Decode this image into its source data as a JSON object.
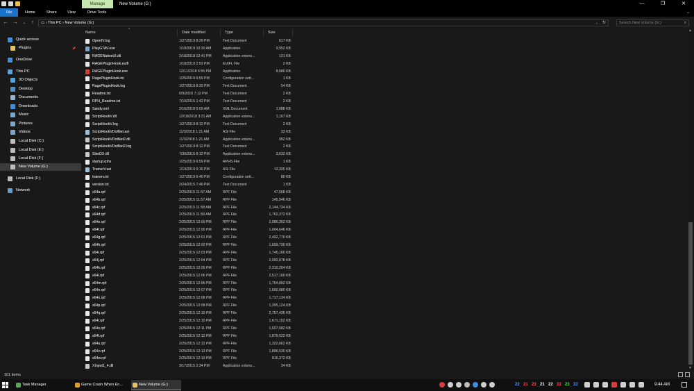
{
  "window": {
    "title": "New Volume (G:)",
    "manage_tab": "Manage",
    "minimize": "—",
    "maximize": "❐",
    "close": "✕"
  },
  "ribbon": {
    "tabs": [
      "File",
      "Home",
      "Share",
      "View",
      "Drive Tools"
    ],
    "expand": "⌄"
  },
  "address": {
    "back": "←",
    "forward": "→",
    "recent": "⌄",
    "up": "↑",
    "path": [
      "This PC",
      "New Volume (G:)"
    ],
    "separator": "›",
    "search_placeholder": "Search New Volume (G:)"
  },
  "sidebar": {
    "items": [
      {
        "label": "Quick access",
        "icon": "star-icon",
        "color": "#3b8ee0",
        "level": 0
      },
      {
        "label": "Plugins",
        "icon": "folder-icon",
        "color": "#e8c25a",
        "level": 1,
        "pinned": true
      },
      {
        "label": "OneDrive",
        "icon": "cloud-icon",
        "color": "#3b8ee0",
        "level": 0
      },
      {
        "label": "This PC",
        "icon": "computer-icon",
        "color": "#5aa0d8",
        "level": 0
      },
      {
        "label": "3D Objects",
        "icon": "cube-icon",
        "color": "#4da3e0",
        "level": 1
      },
      {
        "label": "Desktop",
        "icon": "desktop-icon",
        "color": "#4a90d0",
        "level": 1
      },
      {
        "label": "Documents",
        "icon": "documents-icon",
        "color": "#8fb3d0",
        "level": 1
      },
      {
        "label": "Downloads",
        "icon": "download-icon",
        "color": "#3b8ee0",
        "level": 1
      },
      {
        "label": "Music",
        "icon": "music-icon",
        "color": "#7aa7cf",
        "level": 1
      },
      {
        "label": "Pictures",
        "icon": "pictures-icon",
        "color": "#7aa7cf",
        "level": 1
      },
      {
        "label": "Videos",
        "icon": "videos-icon",
        "color": "#7aa7cf",
        "level": 1
      },
      {
        "label": "Local Disk (C:)",
        "icon": "drive-icon",
        "color": "#bdbdbd",
        "level": 1
      },
      {
        "label": "Local Disk (E:)",
        "icon": "drive-icon",
        "color": "#bdbdbd",
        "level": 1
      },
      {
        "label": "Local Disk (F:)",
        "icon": "drive-icon",
        "color": "#bdbdbd",
        "level": 1
      },
      {
        "label": "New Volume (G:)",
        "icon": "drive-icon",
        "color": "#bdbdbd",
        "level": 1,
        "selected": true
      },
      {
        "label": "Local Disk (F:)",
        "icon": "drive-icon",
        "color": "#bdbdbd",
        "level": 0
      },
      {
        "label": "Network",
        "icon": "network-icon",
        "color": "#5aa0d8",
        "level": 0
      }
    ]
  },
  "columns": {
    "name": "Name",
    "date": "Date modified",
    "type": "Type",
    "size": "Size",
    "sort_indicator": "^"
  },
  "files": [
    {
      "name": "OpenIV.log",
      "date": "1/27/2019 8:29 PM",
      "type": "Text Document",
      "size": "617 KB",
      "kind": "txt"
    },
    {
      "name": "PlayGTAV.exe",
      "date": "1/18/2019 10:30 AM",
      "type": "Application",
      "size": "9,952 KB",
      "kind": "exe"
    },
    {
      "name": "RAGENativeUI.dll",
      "date": "2/18/2018 12:41 PM",
      "type": "Application extens...",
      "size": "121 KB",
      "kind": "dll"
    },
    {
      "name": "RAGEPluginHook.euifi",
      "date": "1/18/2019 2:52 PM",
      "type": "EUIFL File",
      "size": "2 KB",
      "kind": "txt"
    },
    {
      "name": "RAGEPluginHook.exe",
      "date": "12/11/2018 6:55 PM",
      "type": "Application",
      "size": "8,580 KB",
      "kind": "rage"
    },
    {
      "name": "RagePluginHook.ini",
      "date": "1/25/2019 6:59 PM",
      "type": "Configuration sett...",
      "size": "1 KB",
      "kind": "txt"
    },
    {
      "name": "RagePluginHook.log",
      "date": "1/27/2019 8:32 PM",
      "type": "Text Document",
      "size": "54 KB",
      "kind": "txt"
    },
    {
      "name": "Readme.txt",
      "date": "6/9/2016 7:12 PM",
      "type": "Text Document",
      "size": "2 KB",
      "kind": "txt"
    },
    {
      "name": "RPH_Readme.txt",
      "date": "7/10/2015 1:42 PM",
      "type": "Text Document",
      "size": "2 KB",
      "kind": "txt"
    },
    {
      "name": "Sandy.xml",
      "date": "2/16/2018 5:09 AM",
      "type": "XML Document",
      "size": "1,088 KB",
      "kind": "txt"
    },
    {
      "name": "ScriptHookV.dll",
      "date": "12/18/2018 3:21 AM",
      "type": "Application extens...",
      "size": "1,167 KB",
      "kind": "dll"
    },
    {
      "name": "ScriptHookV.log",
      "date": "1/27/2019 8:12 PM",
      "type": "Text Document",
      "size": "2 KB",
      "kind": "txt"
    },
    {
      "name": "ScriptHookVDotNet.asi",
      "date": "11/3/2018 1:21 AM",
      "type": "ASI File",
      "size": "33 KB",
      "kind": "asi"
    },
    {
      "name": "ScriptHookVDotNet2.dll",
      "date": "11/3/2018 1:21 AM",
      "type": "Application extens...",
      "size": "992 KB",
      "kind": "dll"
    },
    {
      "name": "ScriptHookVDotNet2.log",
      "date": "1/27/2019 8:12 PM",
      "type": "Text Document",
      "size": "2 KB",
      "kind": "txt"
    },
    {
      "name": "SlimDX.dll",
      "date": "7/30/2015 8:12 PM",
      "type": "Application extens...",
      "size": "3,632 KB",
      "kind": "dll"
    },
    {
      "name": "startup.rphs",
      "date": "1/25/2019 6:59 PM",
      "type": "RPHS File",
      "size": "1 KB",
      "kind": "txt"
    },
    {
      "name": "TrainerV.asi",
      "date": "1/19/2019 9:15 PM",
      "type": "ASI File",
      "size": "13,305 KB",
      "kind": "asi"
    },
    {
      "name": "trainerv.ini",
      "date": "1/27/2019 6:40 PM",
      "type": "Configuration sett...",
      "size": "80 KB",
      "kind": "txt"
    },
    {
      "name": "version.txt",
      "date": "2/24/2015 7:49 PM",
      "type": "Text Document",
      "size": "1 KB",
      "kind": "txt"
    },
    {
      "name": "x64a.rpf",
      "date": "2/25/2015 11:57 AM",
      "type": "RPF File",
      "size": "47,558 KB",
      "kind": "txt"
    },
    {
      "name": "x64b.rpf",
      "date": "2/25/2015 11:57 AM",
      "type": "RPF File",
      "size": "145,946 KB",
      "kind": "txt"
    },
    {
      "name": "x64c.rpf",
      "date": "2/25/2015 11:58 AM",
      "type": "RPF File",
      "size": "2,144,734 KB",
      "kind": "txt"
    },
    {
      "name": "x64d.rpf",
      "date": "2/25/2015 11:59 AM",
      "type": "RPF File",
      "size": "1,762,372 KB",
      "kind": "txt"
    },
    {
      "name": "x64e.rpf",
      "date": "2/25/2015 12:00 PM",
      "type": "RPF File",
      "size": "2,086,362 KB",
      "kind": "txt"
    },
    {
      "name": "x64f.rpf",
      "date": "2/25/2015 12:00 PM",
      "type": "RPF File",
      "size": "1,004,646 KB",
      "kind": "txt"
    },
    {
      "name": "x64g.rpf",
      "date": "2/25/2015 12:01 PM",
      "type": "RPF File",
      "size": "2,492,770 KB",
      "kind": "txt"
    },
    {
      "name": "x64h.rpf",
      "date": "2/25/2015 12:02 PM",
      "type": "RPF File",
      "size": "1,659,730 KB",
      "kind": "txt"
    },
    {
      "name": "x64i.rpf",
      "date": "2/25/2015 12:03 PM",
      "type": "RPF File",
      "size": "1,745,160 KB",
      "kind": "txt"
    },
    {
      "name": "x64j.rpf",
      "date": "2/25/2015 12:04 PM",
      "type": "RPF File",
      "size": "2,090,078 KB",
      "kind": "txt"
    },
    {
      "name": "x64k.rpf",
      "date": "2/25/2015 12:05 PM",
      "type": "RPF File",
      "size": "2,310,204 KB",
      "kind": "txt"
    },
    {
      "name": "x64l.rpf",
      "date": "2/25/2015 12:06 PM",
      "type": "RPF File",
      "size": "2,517,160 KB",
      "kind": "txt"
    },
    {
      "name": "x64m.rpf",
      "date": "2/25/2015 12:06 PM",
      "type": "RPF File",
      "size": "1,764,892 KB",
      "kind": "txt"
    },
    {
      "name": "x64n.rpf",
      "date": "2/25/2015 12:07 PM",
      "type": "RPF File",
      "size": "1,600,080 KB",
      "kind": "txt"
    },
    {
      "name": "x64o.rpf",
      "date": "2/25/2015 12:08 PM",
      "type": "RPF File",
      "size": "1,717,134 KB",
      "kind": "txt"
    },
    {
      "name": "x64p.rpf",
      "date": "2/25/2015 12:08 PM",
      "type": "RPF File",
      "size": "1,395,124 KB",
      "kind": "txt"
    },
    {
      "name": "x64q.rpf",
      "date": "2/25/2015 12:10 PM",
      "type": "RPF File",
      "size": "2,757,436 KB",
      "kind": "txt"
    },
    {
      "name": "x64r.rpf",
      "date": "2/25/2015 12:10 PM",
      "type": "RPF File",
      "size": "1,671,152 KB",
      "kind": "txt"
    },
    {
      "name": "x64s.rpf",
      "date": "2/25/2015 12:11 PM",
      "type": "RPF File",
      "size": "1,607,682 KB",
      "kind": "txt"
    },
    {
      "name": "x64t.rpf",
      "date": "2/25/2015 12:12 PM",
      "type": "RPF File",
      "size": "1,879,522 KB",
      "kind": "txt"
    },
    {
      "name": "x64u.rpf",
      "date": "2/25/2015 12:12 PM",
      "type": "RPF File",
      "size": "1,322,662 KB",
      "kind": "txt"
    },
    {
      "name": "x64v.rpf",
      "date": "2/25/2015 12:13 PM",
      "type": "RPF File",
      "size": "1,896,530 KB",
      "kind": "txt"
    },
    {
      "name": "x64w.rpf",
      "date": "2/25/2015 12:13 PM",
      "type": "RPF File",
      "size": "915,372 KB",
      "kind": "txt"
    },
    {
      "name": "XInput1_4.dll",
      "date": "3/17/2015 2:34 PM",
      "type": "Application extens...",
      "size": "34 KB",
      "kind": "dll"
    }
  ],
  "status": {
    "item_count": "101 items"
  },
  "taskbar": {
    "apps": [
      {
        "label": "Task Manager",
        "color": "#4caf50",
        "active": false
      },
      {
        "label": "Game Crash When En...",
        "color": "#e0a030",
        "active": false
      },
      {
        "label": "New Volume (G:)",
        "color": "#e8c25a",
        "active": true
      }
    ],
    "tray_numbers": [
      {
        "text": "22",
        "color": "#5aa0ff"
      },
      {
        "text": "21",
        "color": "#ff5050"
      },
      {
        "text": "23",
        "color": "#ff5050"
      },
      {
        "text": "21",
        "color": "#ffffff"
      },
      {
        "text": "22",
        "color": "#ffffff"
      },
      {
        "text": "22",
        "color": "#ff5050"
      },
      {
        "text": "23",
        "color": "#50e050"
      },
      {
        "text": "22",
        "color": "#5aa0ff"
      }
    ],
    "clock": "9:44 AM"
  }
}
